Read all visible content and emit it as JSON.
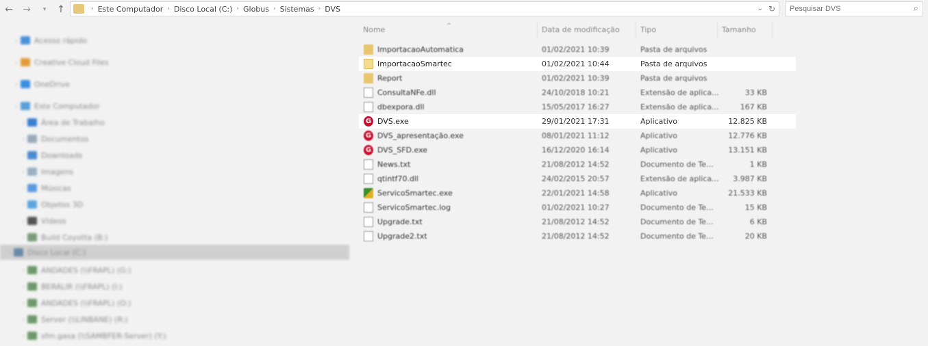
{
  "nav": {
    "back_icon": "←",
    "forward_icon": "→",
    "recent_icon": "▾",
    "up_icon": "↑"
  },
  "address": {
    "crumbs": [
      "Este Computador",
      "Disco Local (C:)",
      "Globus",
      "Sistemas",
      "DVS"
    ],
    "separator": "›",
    "dropdown_icon": "⌄",
    "refresh_icon": "↻"
  },
  "search": {
    "placeholder": "Pesquisar DVS",
    "icon": "⌕"
  },
  "sidebar": {
    "items": [
      {
        "label": "Acesso rápido",
        "color": "#4a90d9"
      },
      {
        "label": "Creative Cloud Files",
        "color": "#e39b3a"
      },
      {
        "label": "OneDrive",
        "color": "#3a8ee0"
      },
      {
        "label": "Este Computador",
        "color": "#5aa0d8"
      },
      {
        "label": "Área de Trabalho",
        "color": "#3a7fd0"
      },
      {
        "label": "Documentos",
        "color": "#9aaab8"
      },
      {
        "label": "Downloads",
        "color": "#4a8ad0"
      },
      {
        "label": "Imagens",
        "color": "#9ab0c4"
      },
      {
        "label": "Músicas",
        "color": "#5a9ae0"
      },
      {
        "label": "Objetos 3D",
        "color": "#5aa6e0"
      },
      {
        "label": "Vídeos",
        "color": "#555555"
      },
      {
        "label": "Build Coyotta (B:)",
        "color": "#7a9a7a"
      },
      {
        "label": "Disco Local (C:)",
        "color": "#6a8aaa"
      },
      {
        "label": "ANDADES (\\\\FRAPL) (G:)",
        "color": "#6a9a6a"
      },
      {
        "label": "BERALIR (\\\\FRAPL) (I:)",
        "color": "#6a9a6a"
      },
      {
        "label": "ANDADES (\\\\FRAPL) (O:)",
        "color": "#6a9a6a"
      },
      {
        "label": "Server (\\\\LINBANE) (R:)",
        "color": "#6a9a6a"
      },
      {
        "label": "sfm.gasa (\\\\SAMBFER-Server) (Y:)",
        "color": "#6a9a6a"
      }
    ]
  },
  "columns": {
    "name": "Nome",
    "date": "Data de modificação",
    "type": "Tipo",
    "size": "Tamanho",
    "sort_icon": "^"
  },
  "files": [
    {
      "name": "ImportacaoAutomatica",
      "date": "01/02/2021 10:39",
      "type": "Pasta de arquivos",
      "size": "",
      "icon": "folder-icon"
    },
    {
      "name": "ImportacaoSmartec",
      "date": "01/02/2021 10:44",
      "type": "Pasta de arquivos",
      "size": "",
      "icon": "folder-icon"
    },
    {
      "name": "Report",
      "date": "01/02/2021 10:39",
      "type": "Pasta de arquivos",
      "size": "",
      "icon": "folder-icon"
    },
    {
      "name": "ConsultaNFe.dll",
      "date": "24/10/2018 10:21",
      "type": "Extensão de aplica...",
      "size": "33 KB",
      "icon": "file-icon"
    },
    {
      "name": "dbexpora.dll",
      "date": "15/05/2017 16:27",
      "type": "Extensão de aplica...",
      "size": "167 KB",
      "icon": "file-icon"
    },
    {
      "name": "DVS.exe",
      "date": "29/01/2021 17:31",
      "type": "Aplicativo",
      "size": "12.825 KB",
      "icon": "globus-app-icon"
    },
    {
      "name": "DVS_apresentação.exe",
      "date": "08/01/2021 11:12",
      "type": "Aplicativo",
      "size": "12.776 KB",
      "icon": "globus-app-icon"
    },
    {
      "name": "DVS_SFD.exe",
      "date": "16/12/2020 16:14",
      "type": "Aplicativo",
      "size": "13.151 KB",
      "icon": "globus-app-icon"
    },
    {
      "name": "News.txt",
      "date": "21/08/2012 14:52",
      "type": "Documento de Te...",
      "size": "1 KB",
      "icon": "file-icon"
    },
    {
      "name": "qtintf70.dll",
      "date": "24/02/2015 20:57",
      "type": "Extensão de aplica...",
      "size": "3.987 KB",
      "icon": "file-icon"
    },
    {
      "name": "ServicoSmartec.exe",
      "date": "22/01/2021 14:58",
      "type": "Aplicativo",
      "size": "21.533 KB",
      "icon": "smartec-icon"
    },
    {
      "name": "ServicoSmartec.log",
      "date": "01/02/2021 10:27",
      "type": "Documento de Te...",
      "size": "15 KB",
      "icon": "file-icon"
    },
    {
      "name": "Upgrade.txt",
      "date": "21/08/2012 14:52",
      "type": "Documento de Te...",
      "size": "6 KB",
      "icon": "file-icon"
    },
    {
      "name": "Upgrade2.txt",
      "date": "21/08/2012 14:52",
      "type": "Documento de Te...",
      "size": "20 KB",
      "icon": "file-icon"
    }
  ]
}
